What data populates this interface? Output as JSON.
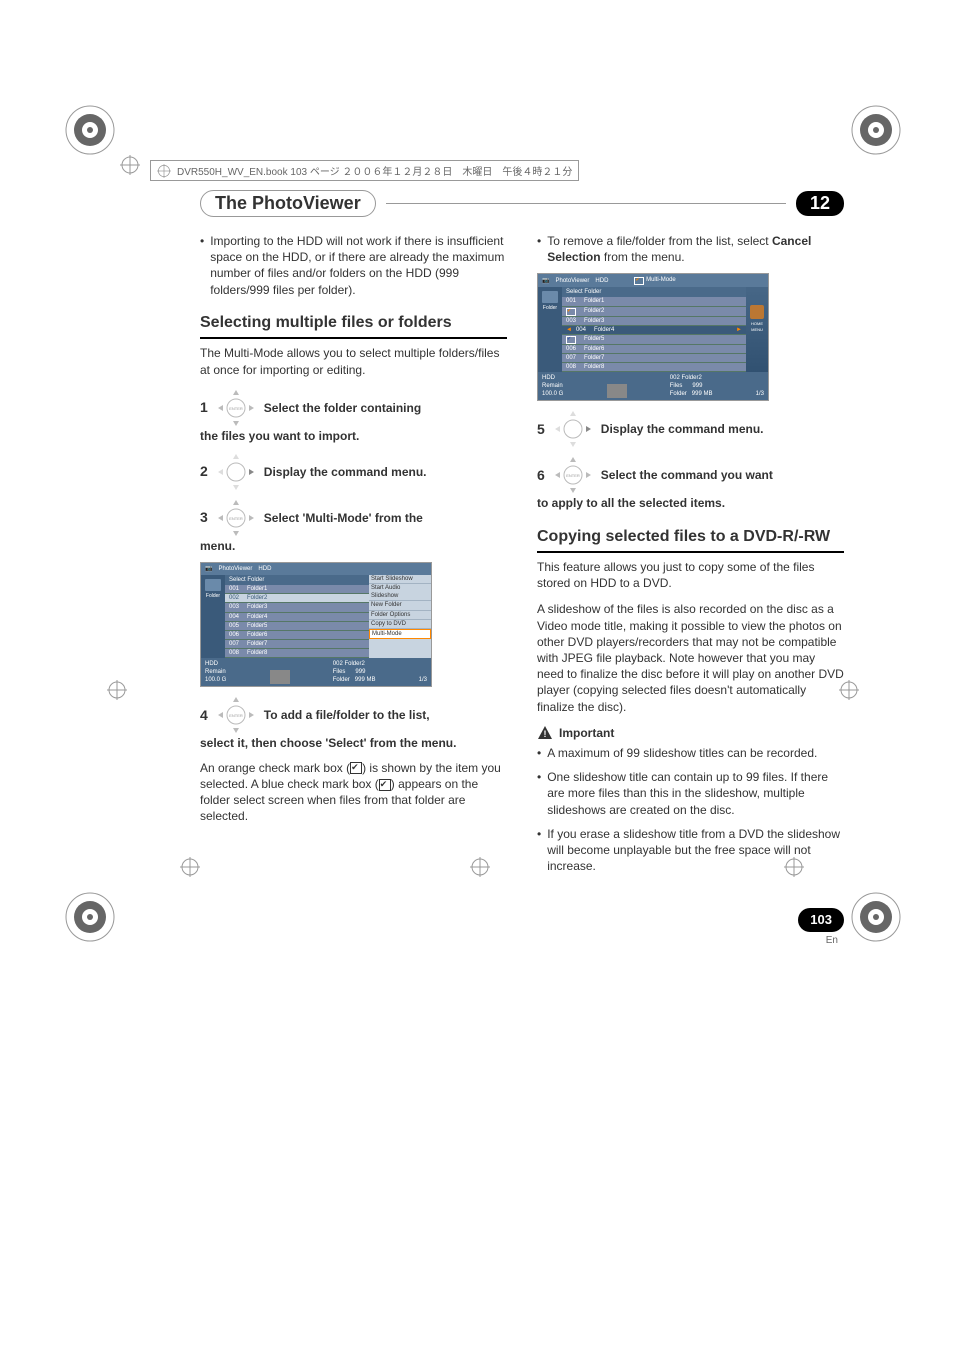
{
  "header_note": {
    "text": "DVR550H_WV_EN.book  103 ページ  ２００６年１２月２８日　木曜日　午後４時２１分"
  },
  "chapter": {
    "title": "The PhotoViewer",
    "number": "12"
  },
  "left": {
    "intro_bullet": "Importing to the HDD will not work if there is insufficient space on the HDD, or if there are already the maximum number of files and/or folders on the HDD (999 folders/999 files per folder).",
    "h2": "Selecting multiple files or folders",
    "para1": "The Multi-Mode allows you to select multiple folders/files at once for importing or editing.",
    "step1_num": "1",
    "step1_text": "Select the folder containing",
    "step1_cont": "the files you want to import.",
    "step2_num": "2",
    "step2_text": "Display the command menu.",
    "step3_num": "3",
    "step3_text": "Select 'Multi-Mode' from the",
    "step3_cont": "menu.",
    "screenshot1": {
      "title": "PhotoViewer",
      "drive": "HDD",
      "list_header": "Select Folder",
      "rows": [
        {
          "num": "001",
          "name": "Folder1"
        },
        {
          "num": "002",
          "name": "Folder2"
        },
        {
          "num": "003",
          "name": "Folder3"
        },
        {
          "num": "004",
          "name": "Folder4"
        },
        {
          "num": "005",
          "name": "Folder5"
        },
        {
          "num": "006",
          "name": "Folder6"
        },
        {
          "num": "007",
          "name": "Folder7"
        },
        {
          "num": "008",
          "name": "Folder8"
        }
      ],
      "menu": [
        "Start Slideshow",
        "Start Audio Slideshow",
        "New Folder",
        "Folder Options",
        "Copy to DVD",
        "Multi-Mode"
      ],
      "side_label": "Folder",
      "footer_left1": "HDD",
      "footer_left2": "Remain",
      "footer_left3": "100.0 G",
      "footer_mid": "002 Folder2\nFiles      999\nFolder   999 MB",
      "footer_right": "1/3"
    },
    "step4_num": "4",
    "step4_text": "To add a file/folder to the list,",
    "step4_cont": "select it, then choose 'Select' from the menu.",
    "para4a": "An orange check mark box (",
    "para4b": ") is shown by the item you selected. A blue check mark box (",
    "para4c": ") appears on the folder select screen when files from that folder are selected."
  },
  "right": {
    "intro_bullet_a": "To remove a file/folder from the list, select ",
    "intro_bullet_bold": "Cancel Selection",
    "intro_bullet_b": " from the menu.",
    "screenshot2": {
      "title": "PhotoViewer",
      "drive": "HDD",
      "mode": "Multi-Mode",
      "list_header": "Select Folder",
      "rows": [
        {
          "num": "001",
          "name": "Folder1",
          "check": false
        },
        {
          "num": "",
          "name": "Folder2",
          "check": true,
          "orange": true
        },
        {
          "num": "003",
          "name": "Folder3",
          "check": false
        },
        {
          "num": "004",
          "name": "Folder4",
          "check": false,
          "arrow": true
        },
        {
          "num": "",
          "name": "Folder5",
          "check": true,
          "blue": true
        },
        {
          "num": "006",
          "name": "Folder6",
          "check": false
        },
        {
          "num": "007",
          "name": "Folder7",
          "check": false
        },
        {
          "num": "008",
          "name": "Folder8",
          "check": false
        }
      ],
      "side_label": "Folder",
      "right_label": "HOME MENU",
      "footer_left1": "HDD",
      "footer_left2": "Remain",
      "footer_left3": "100.0 G",
      "footer_mid": "002 Folder2\nFiles      999\nFolder   999 MB",
      "footer_right": "1/3"
    },
    "step5_num": "5",
    "step5_text": "Display the command menu.",
    "step6_num": "6",
    "step6_text": "Select the command you want",
    "step6_cont": "to apply to all the selected items.",
    "h2": "Copying selected files to a DVD-R/-RW",
    "para1": "This feature allows you just to copy some of the files stored on HDD to a DVD.",
    "para2": "A slideshow of the files is also recorded on the disc as a Video mode title, making it possible to view the photos on other DVD players/recorders that may not be compatible with JPEG file playback. Note however that you may need to finalize the disc before it will play on another DVD player (copying selected files doesn't automatically finalize the disc).",
    "important_label": "Important",
    "imp_bullets": [
      "A maximum of 99 slideshow titles can be recorded.",
      "One slideshow title can contain up to 99 files. If there are more files than this in the slideshow, multiple slideshows are created on the disc.",
      "If you erase a slideshow title from a DVD the slideshow will become unplayable but the free space will not increase."
    ]
  },
  "page_number": "103",
  "page_lang": "En",
  "icons": {
    "enter": "ENTER"
  }
}
